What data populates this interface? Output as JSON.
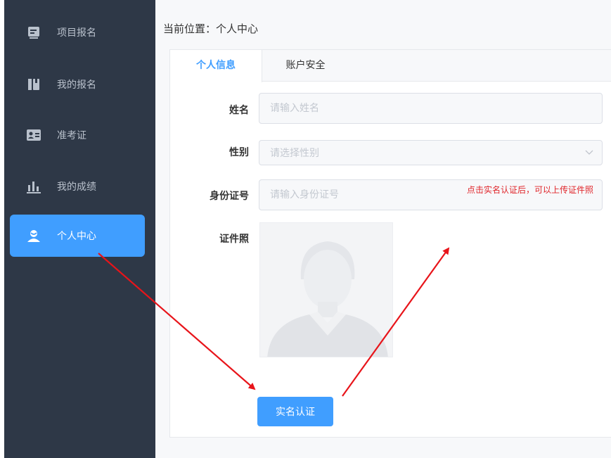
{
  "sidebar": {
    "items": [
      {
        "label": "项目报名",
        "icon": "document-icon",
        "active": false
      },
      {
        "label": "我的报名",
        "icon": "book-icon",
        "active": false
      },
      {
        "label": "准考证",
        "icon": "id-card-icon",
        "active": false
      },
      {
        "label": "我的成绩",
        "icon": "bar-chart-icon",
        "active": false
      },
      {
        "label": "个人中心",
        "icon": "user-icon",
        "active": true
      }
    ]
  },
  "breadcrumb": "当前位置：个人中心",
  "tabs": [
    {
      "label": "个人信息",
      "active": true
    },
    {
      "label": "账户安全",
      "active": false
    }
  ],
  "form": {
    "name": {
      "label": "姓名",
      "placeholder": "请输入姓名"
    },
    "gender": {
      "label": "性别",
      "placeholder": "请选择性别"
    },
    "id_number": {
      "label": "身份证号",
      "placeholder": "请输入身份证号"
    },
    "photo": {
      "label": "证件照"
    }
  },
  "annotation": "点击实名认证后，可以上传证件照",
  "verify_button": "实名认证",
  "colors": {
    "sidebar_bg": "#2e3847",
    "accent": "#409eff",
    "annotation": "#e0262b"
  }
}
